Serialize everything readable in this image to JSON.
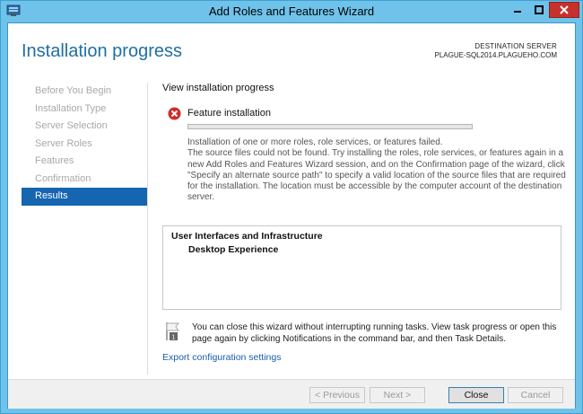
{
  "window": {
    "title": "Add Roles and Features Wizard",
    "accent": "#6fc3ea",
    "close_color": "#c7312b"
  },
  "header": {
    "page_title": "Installation progress",
    "dest_label": "DESTINATION SERVER",
    "dest_value": "PLAGUE-SQL2014.PLAGUEHO.COM"
  },
  "nav": {
    "items": [
      {
        "label": "Before You Begin"
      },
      {
        "label": "Installation Type"
      },
      {
        "label": "Server Selection"
      },
      {
        "label": "Server Roles"
      },
      {
        "label": "Features"
      },
      {
        "label": "Confirmation"
      },
      {
        "label": "Results"
      }
    ],
    "active_index": 6
  },
  "main": {
    "section_label": "View installation progress",
    "feature_title": "Feature installation",
    "status_icon": "error-icon",
    "progress_fraction": 0.0,
    "message_line1": "Installation of one or more roles, role services, or features failed.",
    "message_body": "The source files could not be found. Try installing the roles, role services, or features again in a new Add Roles and Features Wizard session, and on the Confirmation page of the wizard, click \"Specify an alternate source path\" to specify a valid location of the source files that are required for the installation. The location must be accessible by the computer account of the destination server.",
    "results": {
      "line1": "User Interfaces and Infrastructure",
      "line2": "Desktop Experience"
    },
    "note": "You can close this wizard without interrupting running tasks. View task progress or open this page again by clicking Notifications in the command bar, and then Task Details.",
    "export_link": "Export configuration settings"
  },
  "footer": {
    "prev_label": "< Previous",
    "next_label": "Next >",
    "close_label": "Close",
    "cancel_label": "Cancel"
  }
}
